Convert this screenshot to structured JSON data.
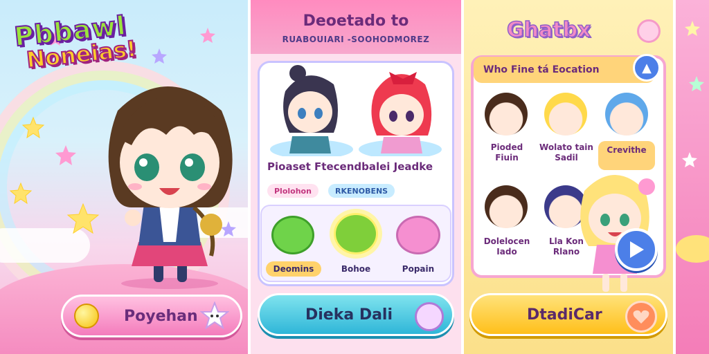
{
  "screen1": {
    "logo_line1": "Pbbawl",
    "logo_line2": "Noneias!",
    "cta_label": "Poyehan"
  },
  "screen2": {
    "title": "Deoetado to",
    "subtitle": "RUABOUIARI -SOOHODMOREZ",
    "section_title": "Pioaset Ftecendbalei Jeadke",
    "tags": [
      "Plolohon",
      "RKENOBENS"
    ],
    "pets": [
      {
        "label": "Deomins",
        "color": "#6fd34a"
      },
      {
        "label": "Bohoe",
        "color": "#7fcf3a"
      },
      {
        "label": "Popain",
        "color": "#f58fd0"
      }
    ],
    "cta_label": "Dieka Dali"
  },
  "screen3": {
    "title": "Ghatbx",
    "question": "Who Fine tá Eocation",
    "characters_row1": [
      {
        "label": "Pioded Fiuin",
        "hair": "#4a2c1c"
      },
      {
        "label": "Wolato tain Sadil",
        "hair": "#ffd94a"
      },
      {
        "label": "Crevithe",
        "hair": "#5fa8ea"
      }
    ],
    "characters_row2": [
      {
        "label": "Dolelocen Iado",
        "hair": "#4a2c1c"
      },
      {
        "label": "Lla Kon Rlano",
        "hair": "#3b3a8a"
      }
    ],
    "cta_label": "DtadiCar"
  }
}
